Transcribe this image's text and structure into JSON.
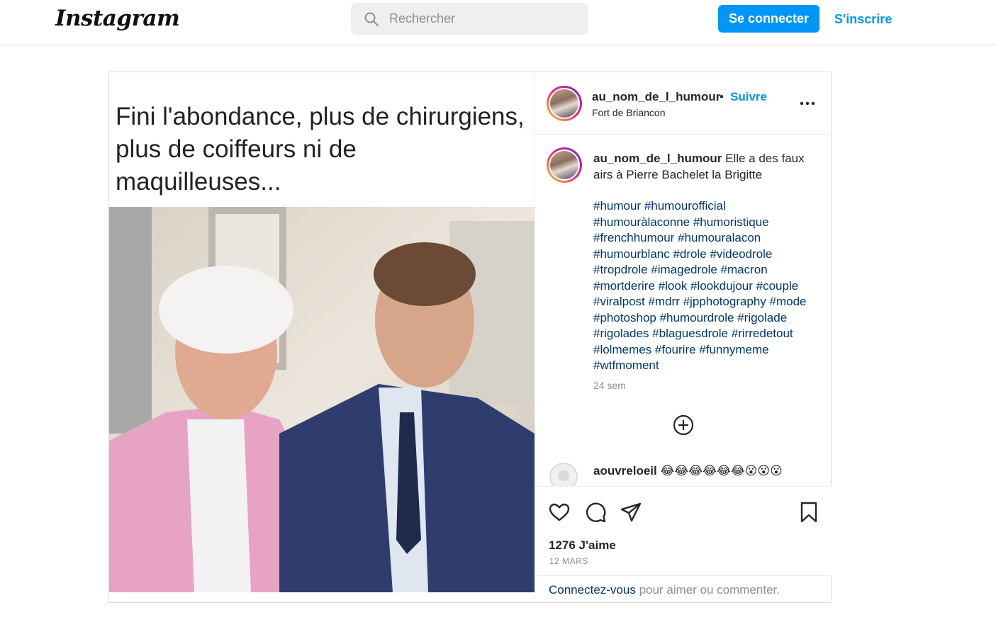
{
  "header": {
    "logo": "Instagram",
    "search_placeholder": "Rechercher",
    "login_label": "Se connecter",
    "signup_label": "S'inscrire"
  },
  "post": {
    "image_text": "Fini l'abondance, plus de chirurgiens,\nplus de coiffeurs ni de\nmaquilleuses...",
    "username": "au_nom_de_l_humour",
    "dot": "•",
    "follow_label": "Suivre",
    "location": "Fort de Briancon",
    "caption_user": "au_nom_de_l_humour",
    "caption_text": "Elle a des faux airs à Pierre Bachelet la Brigitte",
    "hashtags": "#humour #humourofficial #humouràlaconne #humoristique #frenchhumour #humouralacon #humourblanc #drole #videodrole #tropdrole #imagedrole #macron #mortderire #look #lookdujour #couple #viralpost #mdrr #jpphotography #mode #photoshop #humourdrole #rigolade #rigolades #blaguesdrole #rirredetout #lolmemes #fourire #funnymeme #wtfmoment",
    "time_ago": "24 sem",
    "comment_user": "aouvreloeil",
    "comment_text": "😂😂😂😂😂😂😮😮😮",
    "likes": "1276 J'aime",
    "date": "12 MARS",
    "footer_link": "Connectez-vous",
    "footer_text": " pour aimer ou commenter."
  },
  "icons": [
    "search-icon",
    "more-icon",
    "add-comment-icon",
    "like-icon",
    "comment-icon",
    "share-icon",
    "save-icon"
  ],
  "colors": {
    "accent": "#0095f6",
    "hashtag": "#00376b",
    "muted": "#8e8e8e"
  }
}
